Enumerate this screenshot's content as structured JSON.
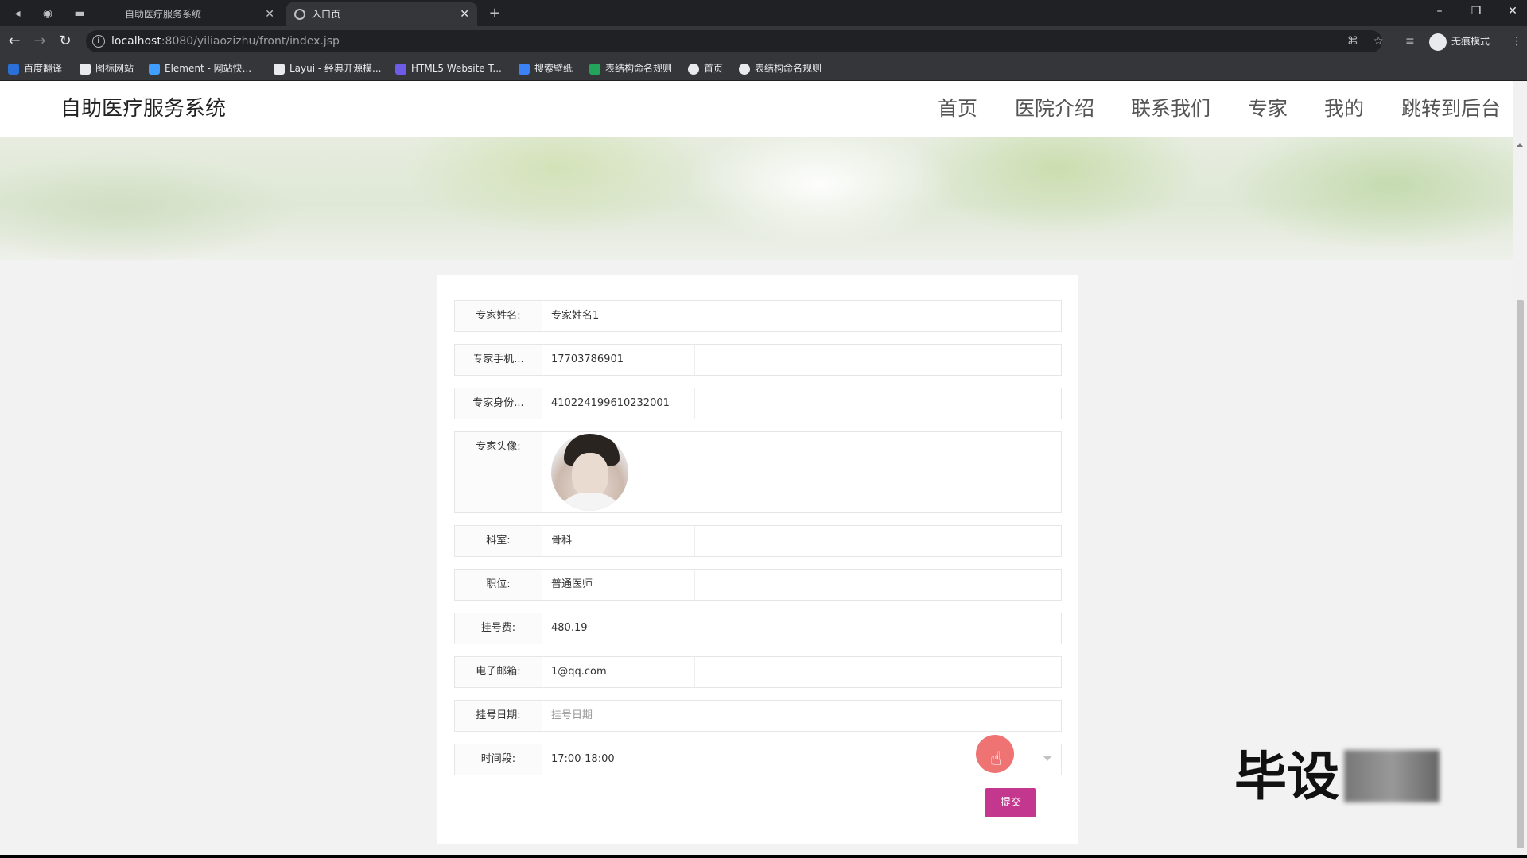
{
  "browser": {
    "tabs": [
      {
        "title": "自助医疗服务系统",
        "active": false
      },
      {
        "title": "入口页",
        "active": true
      }
    ],
    "url_host": "localhost",
    "url_rest": ":8080/yiliaozizhu/front/index.jsp",
    "incognito_label": "无痕模式",
    "bookmarks": [
      {
        "label": "百度翻译",
        "color": "#2b6fd9"
      },
      {
        "label": "图标网站",
        "color": "#e8eaed"
      },
      {
        "label": "Element - 网站快...",
        "color": "#409eff"
      },
      {
        "label": "Layui - 经典开源模...",
        "color": "#e8eaed"
      },
      {
        "label": "HTML5 Website T...",
        "color": "#6c5ce7"
      },
      {
        "label": "搜索壁纸",
        "color": "#3b82f6"
      },
      {
        "label": "表结构命名规则",
        "color": "#22a55a"
      },
      {
        "label": "首页",
        "color": "#e8eaed"
      },
      {
        "label": "表结构命名规则",
        "color": "#e8eaed"
      }
    ]
  },
  "site": {
    "title": "自助医疗服务系统",
    "nav": [
      "首页",
      "医院介绍",
      "联系我们",
      "专家",
      "我的",
      "跳转到后台"
    ]
  },
  "form": {
    "fields": [
      {
        "label": "专家姓名:",
        "value": "专家姓名1"
      },
      {
        "label": "专家手机...",
        "value": "17703786901"
      },
      {
        "label": "专家身份...",
        "value": "410224199610232001"
      },
      {
        "label": "专家头像:"
      },
      {
        "label": "科室:",
        "value": "骨科"
      },
      {
        "label": "职位:",
        "value": "普通医师"
      },
      {
        "label": "挂号费:",
        "value": "480.19"
      },
      {
        "label": "电子邮箱:",
        "value": "1@qq.com"
      },
      {
        "label": "挂号日期:",
        "placeholder": "挂号日期"
      },
      {
        "label": "时间段:",
        "value": "17:00-18:00"
      }
    ],
    "submit_label": "提交"
  },
  "watermark": "毕设"
}
